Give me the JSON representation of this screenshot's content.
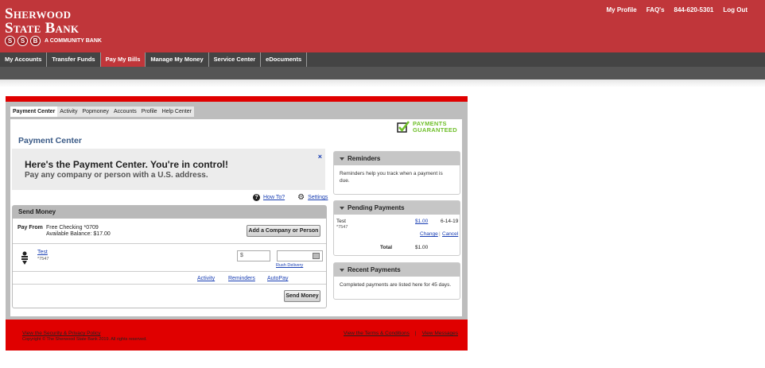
{
  "bank": {
    "name_line1": "Sherwood",
    "name_line2": "State Bank",
    "badge_letters": [
      "S",
      "S",
      "B"
    ],
    "tagline": "A COMMUNITY BANK"
  },
  "top_links": {
    "profile": "My Profile",
    "faqs": "FAQ's",
    "phone": "844-620-5301",
    "logout": "Log Out"
  },
  "main_nav": [
    "My Accounts",
    "Transfer Funds",
    "Pay My Bills",
    "Manage My Money",
    "Service Center",
    "eDocuments"
  ],
  "tabs": [
    "Payment Center",
    "Activity",
    "Popmoney",
    "Accounts",
    "Profile",
    "Help Center"
  ],
  "guarantee": {
    "line1": "PAYMENTS",
    "line2": "GUARANTEED"
  },
  "panel_title": "Payment Center",
  "intro": {
    "heading": "Here's the Payment Center. You're in control!",
    "subheading": "Pay any company or person with a U.S. address.",
    "close": "×"
  },
  "help": {
    "howto": "How To?",
    "settings": "Settings"
  },
  "send_money": {
    "title": "Send Money",
    "pay_from_label": "Pay From",
    "account": "Free Checking *0709",
    "balance": "Available Balance: $17.00",
    "add_button": "Add a Company or Person",
    "payee_name": "Test",
    "payee_acct": "*7547",
    "amount_prefix": "$",
    "rush": "Rush Delivery",
    "links": [
      "Activity",
      "Reminders",
      "AutoPay"
    ],
    "send_button": "Send Money"
  },
  "reminders": {
    "title": "Reminders",
    "body": "Reminders help you track when a payment is due."
  },
  "pending": {
    "title": "Pending Payments",
    "payee": "Test",
    "payee_acct": "*7547",
    "amount": "$1.00",
    "date": "6-14-19",
    "change": "Change",
    "cancel": "Cancel",
    "total_label": "Total",
    "total": "$1.00"
  },
  "recent": {
    "title": "Recent Payments",
    "body": "Completed payments are listed here for 45 days."
  },
  "footer": {
    "security": "View the Security & Privacy Policy",
    "copyright": "Copyright © The Sherwood State Bank 2019. All rights reserved.",
    "terms": "View the Terms & Conditions",
    "separator": "|",
    "messages": "View Messages"
  },
  "colors": {
    "header_red": "#c0363a",
    "frame_red": "#e00000",
    "nav_dark": "#444444",
    "guarantee_green": "#6fbf2a",
    "title_blue": "#3a5a86"
  }
}
